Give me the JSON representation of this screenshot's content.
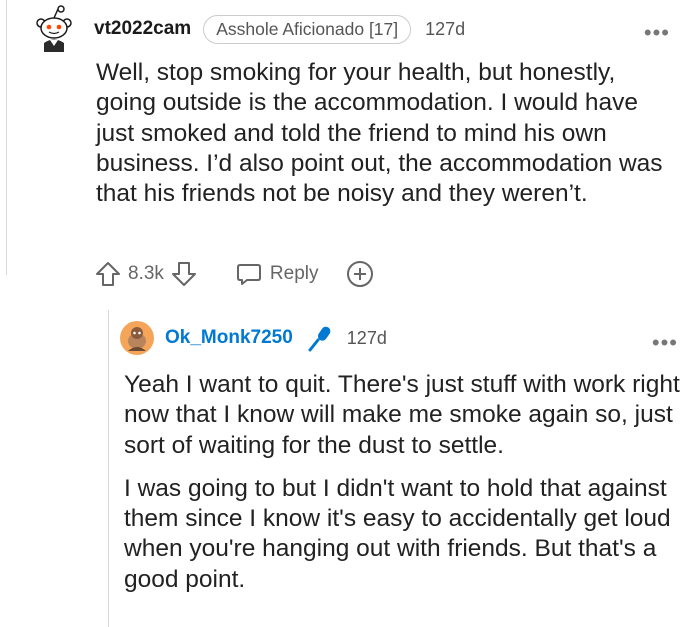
{
  "comment": {
    "username": "vt2022cam",
    "flair": "Asshole Aficionado [17]",
    "age": "127d",
    "more": "•••",
    "paragraphs": [
      "Well, stop smoking for your health, but honestly, going outside is the accommodation. I would have just smoked and told the friend to mind his own business. I’d also point out, the accommodation was that his friends not be noisy and they weren’t."
    ],
    "votes": "8.3k",
    "reply_label": "Reply"
  },
  "reply": {
    "username": "Ok_Monk7250",
    "age": "127d",
    "more": "•••",
    "paragraphs": [
      "Yeah I want to quit. There's just stuff with work right now that I know will make me smoke again so, just sort of waiting for the dust to settle.",
      "I was going to but I didn't want to hold that against them since I know it's easy to accidentally get loud when you're hanging out with friends. But that's a good point."
    ]
  },
  "icons": [
    "snoo-avatar-icon",
    "upvote-icon",
    "downvote-icon",
    "reply-icon",
    "award-icon",
    "avatar-icon",
    "microphone-icon",
    "more-icon"
  ],
  "colors": {
    "username_link": "#0079d3",
    "meta": "#555555",
    "thread_line": "#d7dadc"
  }
}
